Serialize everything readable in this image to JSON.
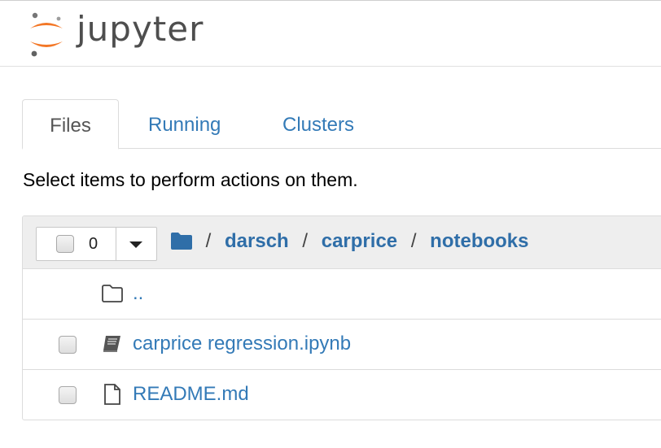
{
  "app": {
    "logo_text": "jupyter"
  },
  "tabs": [
    {
      "label": "Files",
      "active": true
    },
    {
      "label": "Running",
      "active": false
    },
    {
      "label": "Clusters",
      "active": false
    }
  ],
  "hint": "Select items to perform actions on them.",
  "toolbar": {
    "selected_count": "0"
  },
  "breadcrumb": {
    "root": "/",
    "items": [
      "darsch",
      "carprice",
      "notebooks"
    ],
    "separator": "/"
  },
  "files": [
    {
      "name": "..",
      "icon": "folder-outline-icon",
      "has_checkbox": false
    },
    {
      "name": "carprice regression.ipynb",
      "icon": "notebook-icon",
      "has_checkbox": true
    },
    {
      "name": "README.md",
      "icon": "file-icon",
      "has_checkbox": true
    }
  ],
  "colors": {
    "link": "#337ab7",
    "logo_orange": "#f37726",
    "header_bg": "#eeeeee"
  }
}
